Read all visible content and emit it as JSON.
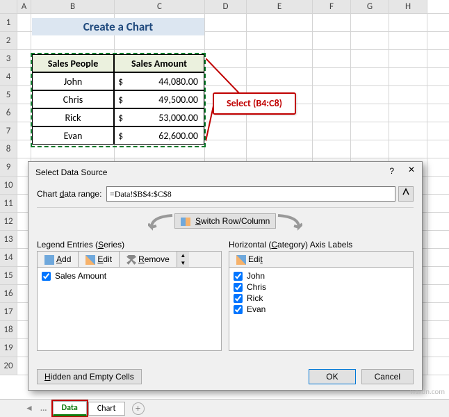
{
  "columns": [
    "A",
    "B",
    "C",
    "D",
    "E",
    "F",
    "G",
    "H"
  ],
  "rows": [
    "1",
    "2",
    "3",
    "4",
    "5",
    "6",
    "7",
    "8",
    "9",
    "10",
    "11",
    "12",
    "13",
    "14",
    "15",
    "16",
    "17",
    "18",
    "19",
    "20"
  ],
  "title_box": "Create a Chart",
  "table": {
    "head1": "Sales People",
    "head2": "Sales Amount",
    "rows": [
      {
        "name": "John",
        "cur": "$",
        "amt": "44,080.00"
      },
      {
        "name": "Chris",
        "cur": "$",
        "amt": "49,500.00"
      },
      {
        "name": "Rick",
        "cur": "$",
        "amt": "53,000.00"
      },
      {
        "name": "Evan",
        "cur": "$",
        "amt": "62,600.00"
      }
    ]
  },
  "callout": "Select (B4:C8)",
  "dialog": {
    "title": "Select Data Source",
    "help": "?",
    "close": "✕",
    "range_label": "Chart data range:",
    "range_value": "=Data!$B$4:$C$8",
    "switch": "Switch Row/Column",
    "legend_label": "Legend Entries (Series)",
    "legend_add": "Add",
    "legend_edit": "Edit",
    "legend_remove": "Remove",
    "series": [
      "Sales Amount"
    ],
    "axis_label": "Horizontal (Category) Axis Labels",
    "axis_edit": "Edit",
    "categories": [
      "John",
      "Chris",
      "Rick",
      "Evan"
    ],
    "hidden": "Hidden and Empty Cells",
    "ok": "OK",
    "cancel": "Cancel"
  },
  "tabs": {
    "dots": "...",
    "t1": "Data",
    "t2": "Chart",
    "add": "+"
  },
  "watermark": "wsxdn.com",
  "chart_data": {
    "type": "table",
    "title": "Create a Chart",
    "columns": [
      "Sales People",
      "Sales Amount"
    ],
    "rows": [
      [
        "John",
        44080.0
      ],
      [
        "Chris",
        49500.0
      ],
      [
        "Rick",
        53000.0
      ],
      [
        "Evan",
        62600.0
      ]
    ],
    "selected_range": "B4:C8",
    "sheet": "Data"
  }
}
